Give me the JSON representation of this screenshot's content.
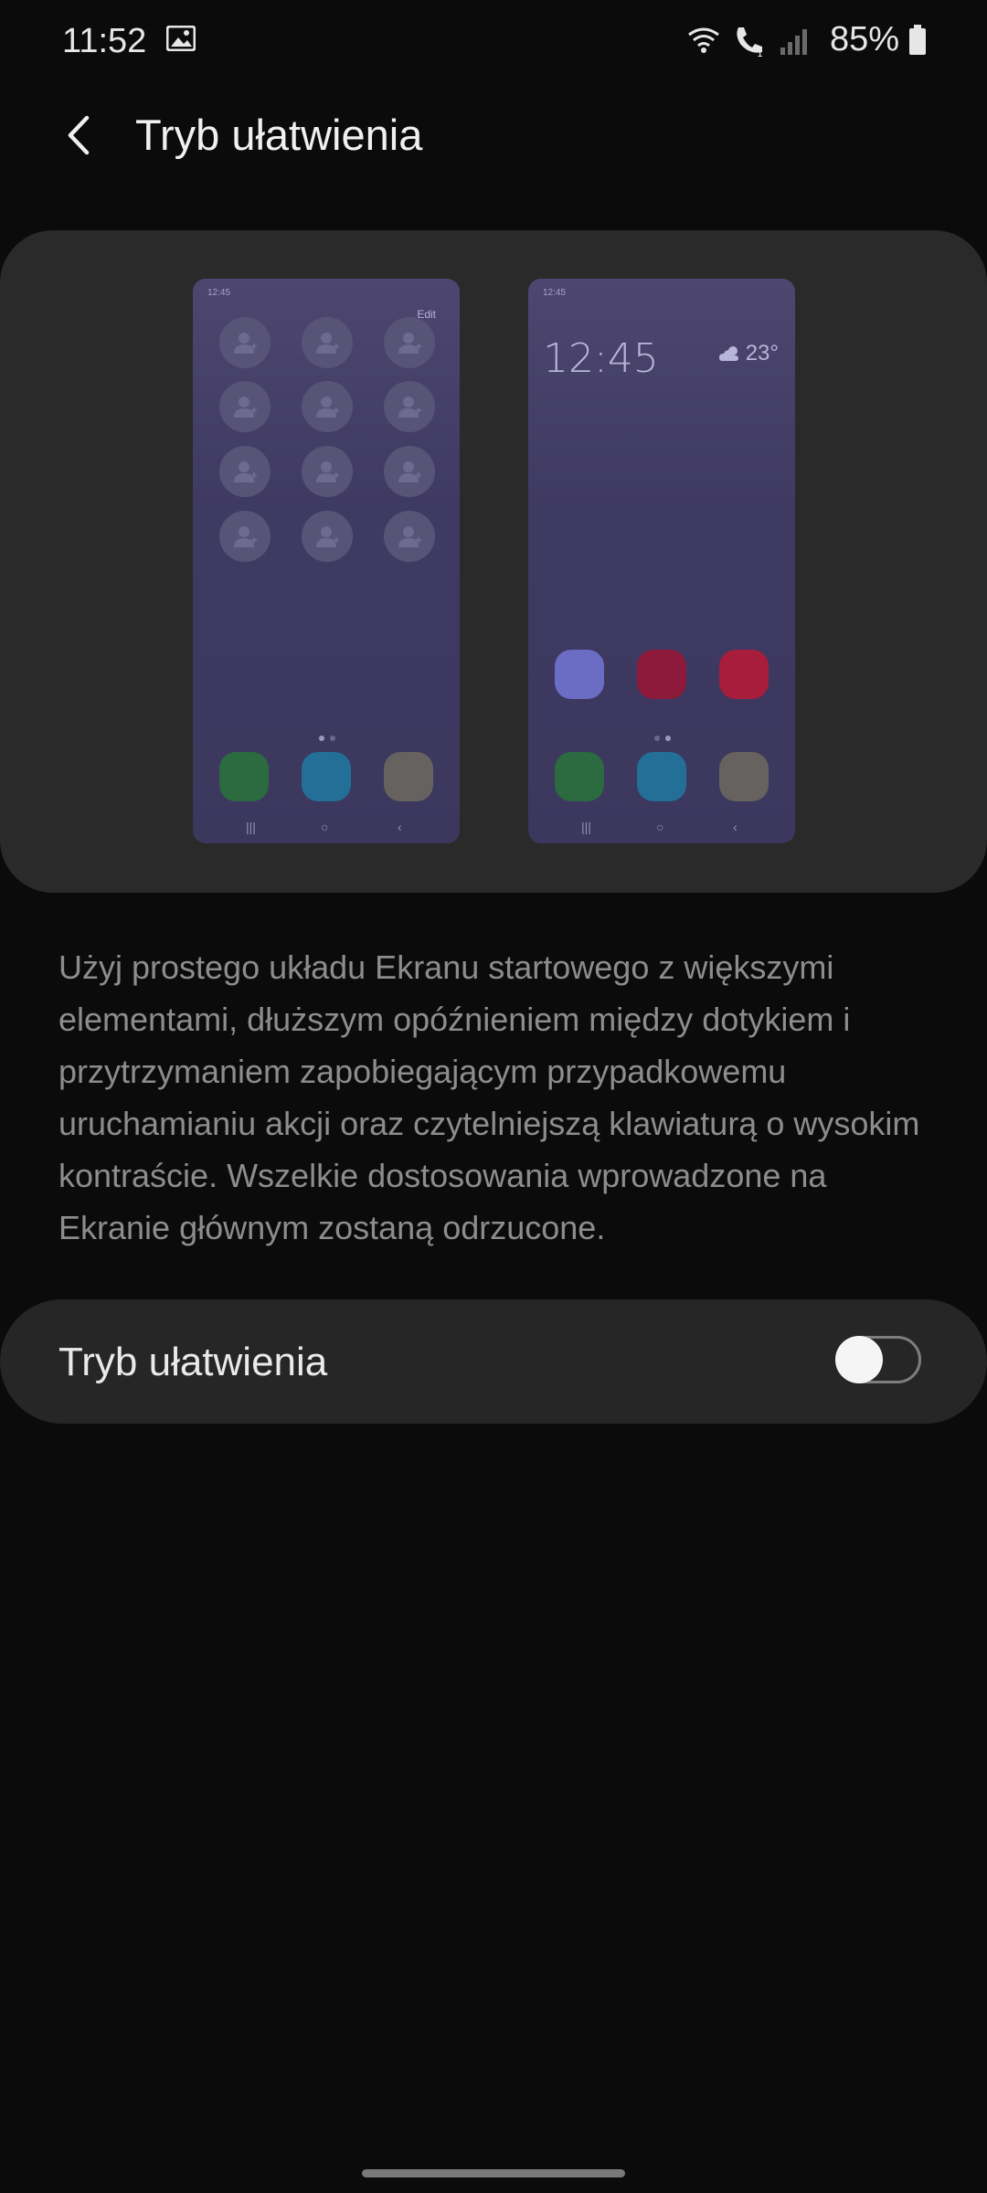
{
  "status_bar": {
    "time": "11:52",
    "battery": "85%",
    "icons": [
      "gallery-icon",
      "wifi-icon",
      "wifi-call-icon",
      "signal-icon",
      "battery-icon"
    ]
  },
  "app_bar": {
    "title": "Tryb ułatwienia",
    "back_icon": "chevron-left-icon"
  },
  "preview": {
    "left_phone": {
      "time": "12:45",
      "edit": "Edit"
    },
    "right_phone": {
      "time": "12:45",
      "clock": "12:45",
      "temperature": "23°",
      "weather_icon": "cloud-sun-icon"
    },
    "colors": {
      "green": "#2b6b3f",
      "blue": "#236f98",
      "gray": "#65625f",
      "periwinkle": "#6b6cc3",
      "crimson": "#8d1a3a",
      "red": "#a81d3c"
    }
  },
  "description": "Użyj prostego układu Ekranu startowego z większymi elementami, dłuższym opóźnieniem między dotykiem i przytrzymaniem zapobiegającym przypadkowemu uruchamianiu akcji oraz czytelniejszą klawiaturą o wysokim kontraście. Wszelkie dostosowania wprowadzone na Ekranie głównym zostaną odrzucone.",
  "toggle": {
    "label": "Tryb ułatwienia",
    "state": "off"
  }
}
